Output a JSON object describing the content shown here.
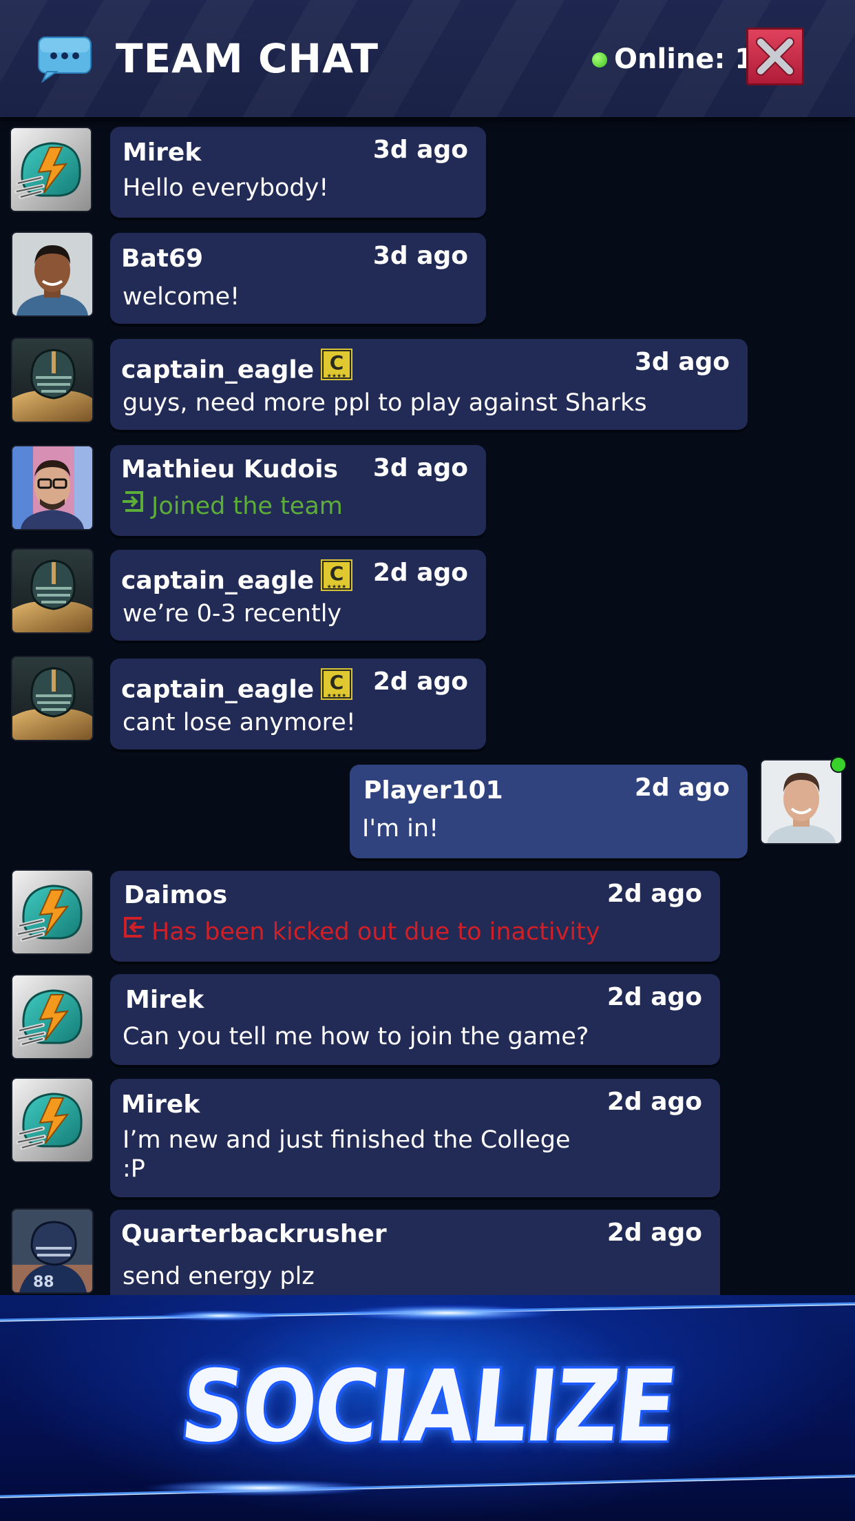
{
  "header": {
    "title": "TEAM CHAT",
    "online_text": "Online: 1",
    "chat_icon": "speech-bubble-icon",
    "close_icon": "close-icon",
    "colors": {
      "header_bg": "#1f2750",
      "online": "#3fc21d",
      "close": "#c8243f"
    }
  },
  "messages": [
    {
      "user": "Mirek",
      "time": "3d ago",
      "text": "Hello everybody!",
      "avatar": "helmet-avatar"
    },
    {
      "user": "Bat69",
      "time": "3d ago",
      "text": "welcome!",
      "avatar": "photo-avatar"
    },
    {
      "user": "captain_eagle",
      "time": "3d ago",
      "text": "guys, need more ppl to play against Sharks",
      "avatar": "football-player-avatar",
      "captain_badge": "C"
    },
    {
      "user": "Mathieu Kudois",
      "time": "3d ago",
      "text": "Joined the team",
      "avatar": "photo-avatar",
      "status": "joined",
      "status_icon": "enter-icon"
    },
    {
      "user": "captain_eagle",
      "time": "2d ago",
      "text": "we’re 0-3 recently",
      "avatar": "football-player-avatar",
      "captain_badge": "C"
    },
    {
      "user": "captain_eagle",
      "time": "2d ago",
      "text": "cant lose anymore!",
      "avatar": "football-player-avatar",
      "captain_badge": "C"
    },
    {
      "user": "Player101",
      "time": "2d ago",
      "text": "I'm in!",
      "avatar": "photo-avatar",
      "self": true,
      "online": true
    },
    {
      "user": "Daimos",
      "time": "2d ago",
      "text": "Has been kicked out due to inactivity",
      "avatar": "helmet-avatar",
      "status": "kicked",
      "status_icon": "exit-icon"
    },
    {
      "user": "Mirek",
      "time": "2d ago",
      "text": "Can you tell me how to join the game?",
      "avatar": "helmet-avatar"
    },
    {
      "user": "Mirek",
      "time": "2d ago",
      "text": "I’m new and just finished the College :P",
      "avatar": "helmet-avatar"
    },
    {
      "user": "Quarterbackrusher",
      "time": "2d ago",
      "text": "send energy plz",
      "avatar": "football-player-avatar"
    }
  ],
  "footer": {
    "banner_text": "SOCIALIZE"
  },
  "colors": {
    "background": "#050c18",
    "bubble": "#222a56",
    "self_bubble": "#31437f",
    "joined": "#5dae38",
    "kicked": "#cf2027"
  }
}
